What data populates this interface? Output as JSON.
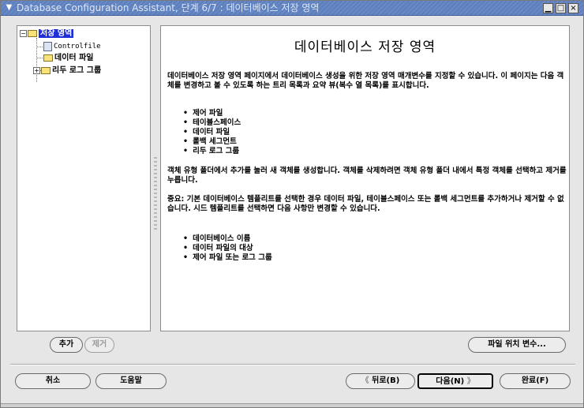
{
  "window": {
    "title": "Database Configuration Assistant, 단계 6/7 : 데이터베이스 저장 영역",
    "menu_glyph": "▼",
    "minimize_glyph": "▁",
    "maximize_glyph": "□",
    "close_glyph": "×"
  },
  "tree": {
    "root_label": "저장 영역",
    "root_toggle": "−",
    "items": [
      {
        "label": "Controlfile"
      },
      {
        "label": "데이터 파일"
      },
      {
        "label": "리두 로그 그룹",
        "toggle": "+"
      }
    ]
  },
  "content": {
    "heading": "데이터베이스 저장 영역",
    "intro": "데이터베이스 저장 영역 페이지에서 데이터베이스 생성을 위한 저장 영역 매개변수를 지정할 수 있습니다. 이 페이지는 다음 객체를 변경하고 볼 수 있도록 하는 트리 목록과 요약 뷰(복수 열 목록)를 표시합니다.",
    "object_list": [
      "제어 파일",
      "테이블스페이스",
      "데이터 파일",
      "롤백 세그먼트",
      "리두 로그 그룹"
    ],
    "create_remove_text": "객체 유형 폴더에서 추가를 눌러 새 객체를 생성합니다. 객체를 삭제하려면 객체 유형 폴더 내에서 특정 객체를 선택하고 제거를 누릅니다.",
    "note_text": "중요: 기본 데이터베이스 템플리트를 선택한 경우 데이터 파일, 테이블스페이스 또는 롤백 세그먼트를 추가하거나 제거할 수 없습니다. 시드 템플리트를 선택하면 다음 사항만 변경할 수 있습니다.",
    "changeable_list": [
      "데이터베이스 이름",
      "데이터 파일의 대상",
      "제어 파일 또는 로그 그룹"
    ]
  },
  "tree_buttons": {
    "add": "추가",
    "remove": "제거"
  },
  "file_location_button": "파일 위치 변수...",
  "footer": {
    "cancel": "취소",
    "help": "도움말",
    "back": "뒤로(B)",
    "back_arrow": "《",
    "next": "다음(N)",
    "next_arrow": "》",
    "finish": "완료(F)"
  }
}
